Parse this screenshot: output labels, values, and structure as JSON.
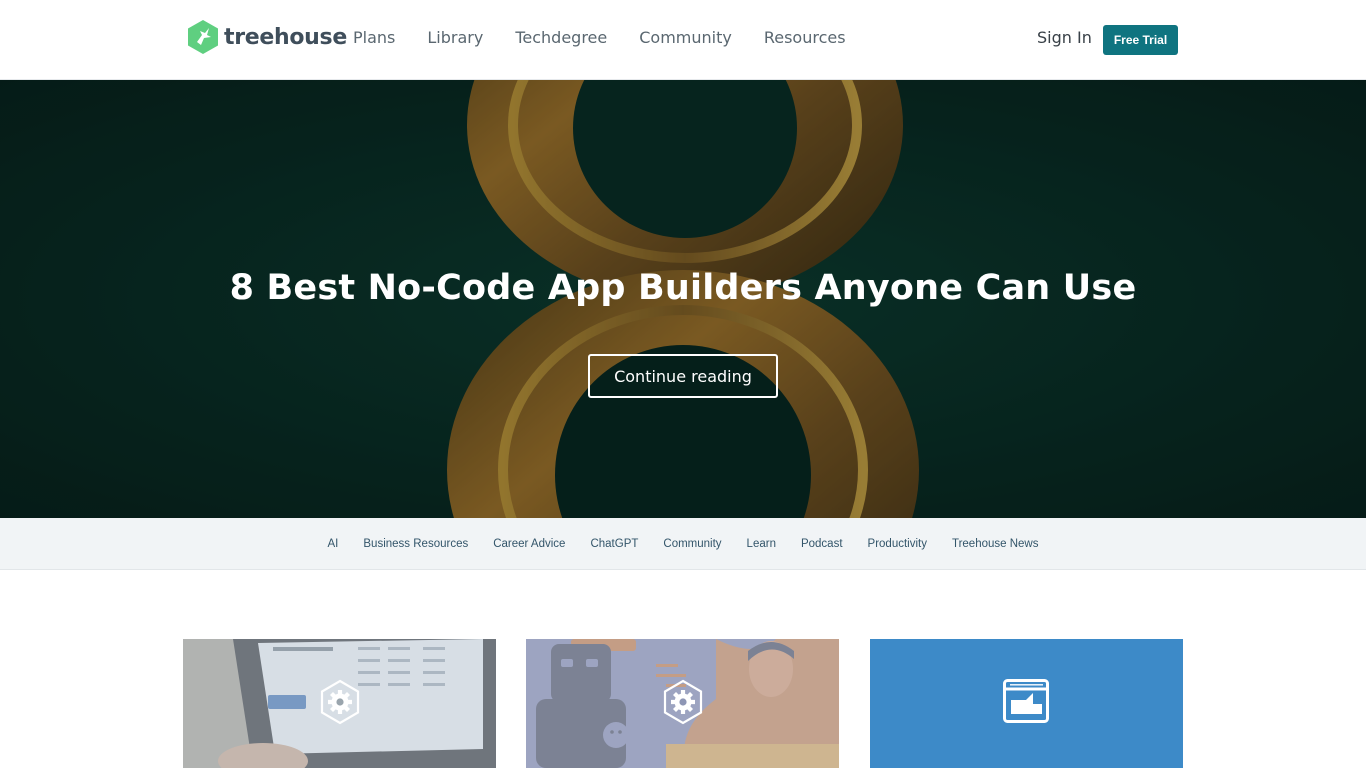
{
  "header": {
    "logo_text": "treehouse",
    "nav": [
      {
        "label": "Plans"
      },
      {
        "label": "Library"
      },
      {
        "label": "Techdegree"
      },
      {
        "label": "Community"
      },
      {
        "label": "Resources"
      }
    ],
    "sign_in": "Sign In",
    "free_trial": "Free Trial"
  },
  "hero": {
    "title": "8 Best No-Code App Builders Anyone Can Use",
    "cta": "Continue reading"
  },
  "categories": [
    {
      "label": "AI"
    },
    {
      "label": "Business Resources"
    },
    {
      "label": "Career Advice"
    },
    {
      "label": "ChatGPT"
    },
    {
      "label": "Community"
    },
    {
      "label": "Learn"
    },
    {
      "label": "Podcast"
    },
    {
      "label": "Productivity"
    },
    {
      "label": "Treehouse News"
    }
  ],
  "cards": [
    {
      "icon": "gear-icon"
    },
    {
      "icon": "gear-icon"
    },
    {
      "icon": "article-icon"
    }
  ],
  "colors": {
    "brand_teal": "#0f7480",
    "hero_bg": "#082a24",
    "category_bg": "#f1f4f6",
    "card_blue": "#3d8ac8"
  }
}
